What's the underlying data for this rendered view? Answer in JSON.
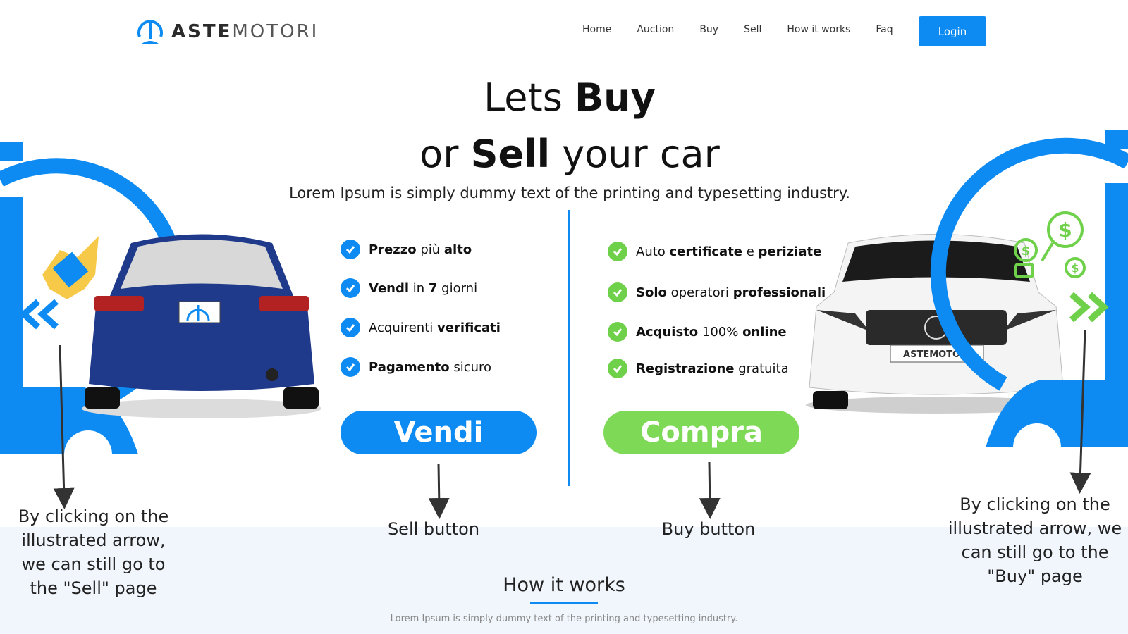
{
  "brand": {
    "name_bold": "ASTE",
    "name_light": "MOTORI"
  },
  "nav": {
    "items": [
      "Home",
      "Auction",
      "Buy",
      "Sell",
      "How it works",
      "Faq"
    ],
    "login_label": "Login"
  },
  "hero": {
    "line1_pre": "Lets ",
    "line1_bold": "Buy",
    "line2_pre": "or ",
    "line2_bold": "Sell",
    "line2_post": " your car",
    "subtitle": "Lorem Ipsum is simply dummy text of the printing and typesetting industry."
  },
  "sell_features": [
    {
      "p1": "",
      "b1": "Prezzo",
      "p2": " più ",
      "b2": "alto",
      "p3": ""
    },
    {
      "p1": "",
      "b1": "Vendi",
      "p2": " in ",
      "b2": "7",
      "p3": " giorni"
    },
    {
      "p1": "Acquirenti ",
      "b1": "verificati",
      "p2": "",
      "b2": "",
      "p3": ""
    },
    {
      "p1": "",
      "b1": "Pagamento",
      "p2": " sicuro",
      "b2": "",
      "p3": ""
    }
  ],
  "buy_features": [
    {
      "p1": "Auto ",
      "b1": "certificate",
      "p2": " e ",
      "b2": "periziate",
      "p3": ""
    },
    {
      "p1": "",
      "b1": "Solo",
      "p2": " operatori ",
      "b2": "professionali",
      "p3": ""
    },
    {
      "p1": "",
      "b1": "Acquisto",
      "p2": " 100% ",
      "b2": "online",
      "p3": ""
    },
    {
      "p1": "",
      "b1": "Registrazione",
      "p2": " gratuita",
      "b2": "",
      "p3": ""
    }
  ],
  "cta": {
    "sell_label": "Vendi",
    "buy_label": "Compra"
  },
  "annotations": {
    "sell_button": "Sell button",
    "buy_button": "Buy button",
    "left_arrow": "By clicking on the illustrated arrow, we can still go to the \"Sell\" page",
    "right_arrow": "By clicking on the illustrated arrow, we can still go to the \"Buy\" page"
  },
  "how_it_works": {
    "title": "How it works",
    "subtitle": "Lorem Ipsum is simply dummy text of the printing and typesetting industry."
  },
  "car_logo_text": "ASTEMOTORI",
  "colors": {
    "blue": "#0d8bf2",
    "green": "#7ed957",
    "band": "#f1f6fd"
  },
  "icons": [
    "logo-icon",
    "check-icon",
    "left-arrow-icon",
    "right-arrow-icon",
    "dollar-icon"
  ]
}
